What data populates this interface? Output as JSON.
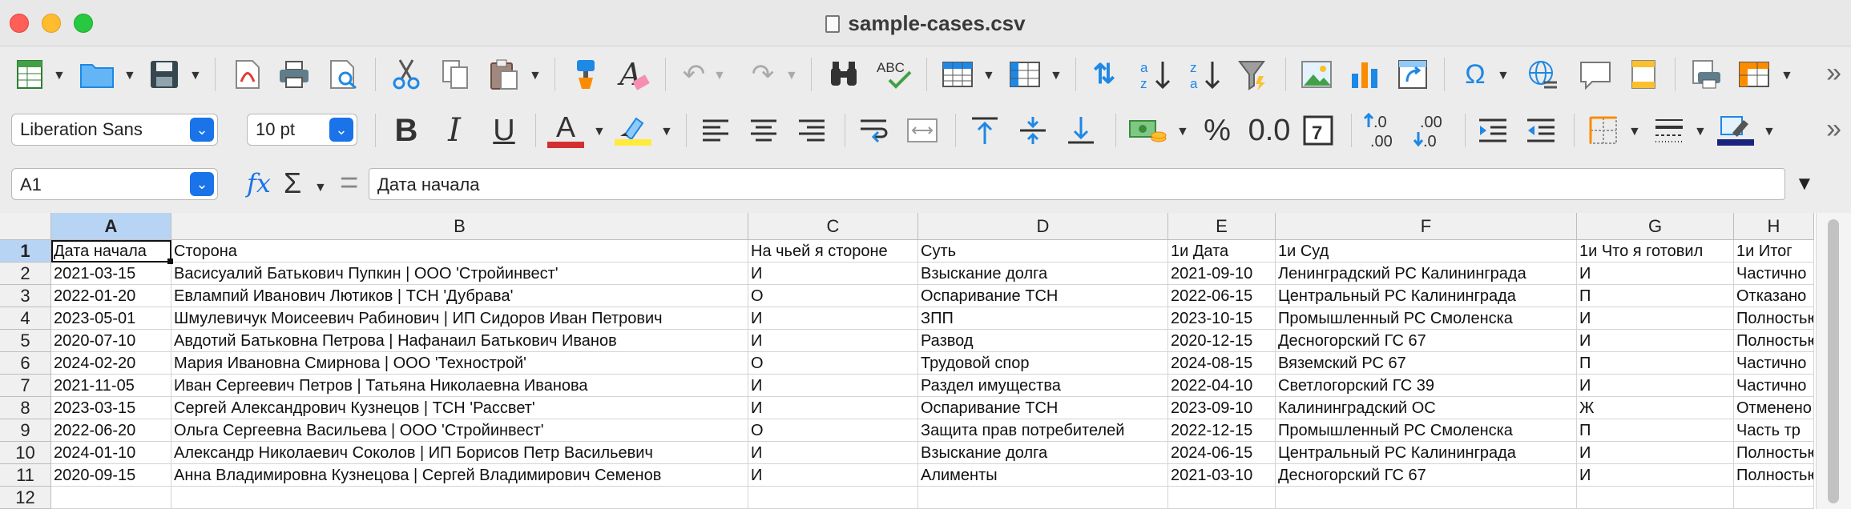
{
  "window": {
    "title": "sample-cases.csv"
  },
  "toolbar2": {
    "font_name": "Liberation Sans",
    "font_size": "10 pt"
  },
  "formula_bar": {
    "cell_ref": "A1",
    "content": "Дата начала"
  },
  "columns": [
    "A",
    "B",
    "C",
    "D",
    "E",
    "F",
    "G",
    "H"
  ],
  "rows": [
    {
      "num": "1",
      "cells": [
        "Дата начала",
        "Сторона",
        "На чьей я стороне",
        "Суть",
        "1и Дата",
        "1и Суд",
        "1и Что я готовил",
        "1и Итог"
      ]
    },
    {
      "num": "2",
      "cells": [
        "2021-03-15",
        "Васисуалий Батькович Пупкин | ООО 'Стройинвест'",
        "И",
        "Взыскание долга",
        "2021-09-10",
        "Ленинградский РС Калининграда",
        "И",
        "Частично"
      ]
    },
    {
      "num": "3",
      "cells": [
        "2022-01-20",
        "Евлампий Иванович Лютиков | ТСН 'Дубрава'",
        "О",
        "Оспаривание ТСН",
        "2022-06-15",
        "Центральный РС Калининграда",
        "П",
        "Отказано"
      ]
    },
    {
      "num": "4",
      "cells": [
        "2023-05-01",
        "Шмулевичук Моисеевич Рабинович | ИП Сидоров Иван Петрович",
        "И",
        "ЗПП",
        "2023-10-15",
        "Промышленный РС Смоленска",
        "И",
        "Полностью"
      ]
    },
    {
      "num": "5",
      "cells": [
        "2020-07-10",
        "Авдотий Батьковна Петрова | Нафанаил Батькович Иванов",
        "И",
        "Развод",
        "2020-12-15",
        "Десногорский ГС 67",
        "И",
        "Полностью"
      ]
    },
    {
      "num": "6",
      "cells": [
        "2024-02-20",
        "Мария Ивановна Смирнова | ООО 'Технострой'",
        "О",
        "Трудовой спор",
        "2024-08-15",
        "Вяземский РС 67",
        "П",
        "Частично"
      ]
    },
    {
      "num": "7",
      "cells": [
        "2021-11-05",
        "Иван Сергеевич Петров | Татьяна Николаевна Иванова",
        "И",
        "Раздел имущества",
        "2022-04-10",
        "Светлогорский ГС 39",
        "И",
        "Частично"
      ]
    },
    {
      "num": "8",
      "cells": [
        "2023-03-15",
        "Сергей Александрович Кузнецов | ТСН 'Рассвет'",
        "И",
        "Оспаривание ТСН",
        "2023-09-10",
        "Калининградский ОС",
        "Ж",
        "Отменено"
      ]
    },
    {
      "num": "9",
      "cells": [
        "2022-06-20",
        "Ольга Сергеевна Васильева | ООО 'Стройинвест'",
        "О",
        "Защита прав потребителей",
        "2022-12-15",
        "Промышленный РС Смоленска",
        "П",
        "Часть тр"
      ]
    },
    {
      "num": "10",
      "cells": [
        "2024-01-10",
        "Александр Николаевич Соколов | ИП Борисов Петр Васильевич",
        "И",
        "Взыскание долга",
        "2024-06-15",
        "Центральный РС Калининграда",
        "И",
        "Полностью"
      ]
    },
    {
      "num": "11",
      "cells": [
        "2020-09-15",
        "Анна Владимировна Кузнецова | Сергей Владимирович Семенов",
        "И",
        "Алименты",
        "2021-03-10",
        "Десногорский ГС 67",
        "И",
        "Полностью"
      ]
    },
    {
      "num": "12",
      "cells": [
        "",
        "",
        "",
        "",
        "",
        "",
        "",
        ""
      ]
    }
  ],
  "icons": {
    "toolbar1": [
      "new-spreadsheet-icon",
      "open-folder-icon",
      "save-icon",
      "export-pdf-icon",
      "print-icon",
      "print-preview-icon",
      "cut-icon",
      "copy-icon",
      "paste-icon",
      "clone-formatting-icon",
      "clear-formatting-icon",
      "undo-icon",
      "redo-icon",
      "find-replace-icon",
      "spelling-icon",
      "row-icon",
      "column-icon",
      "sort-icon",
      "sort-ascending-icon",
      "sort-descending-icon",
      "autofilter-icon",
      "image-icon",
      "chart-icon",
      "pivot-table-icon",
      "special-character-icon",
      "hyperlink-icon",
      "comment-icon",
      "headers-footers-icon",
      "define-print-area-icon",
      "freeze-rows-columns-icon"
    ],
    "toolbar2": [
      "bold-icon",
      "italic-icon",
      "underline-icon",
      "font-color-icon",
      "highlight-icon",
      "align-left-icon",
      "align-center-icon",
      "align-right-icon",
      "wrap-text-icon",
      "merge-cells-icon",
      "align-top-icon",
      "align-middle-icon",
      "align-bottom-icon",
      "currency-format-icon",
      "percent-format-icon",
      "number-format-icon",
      "date-format-icon",
      "add-decimal-icon",
      "delete-decimal-icon",
      "increase-indent-icon",
      "decrease-indent-icon",
      "borders-icon",
      "border-style-icon",
      "border-color-icon"
    ]
  },
  "colors": {
    "accent": "#1a73e8",
    "selection": "#b8d4f5",
    "font_color": "#d32f2f",
    "highlight": "#ffeb3b"
  }
}
